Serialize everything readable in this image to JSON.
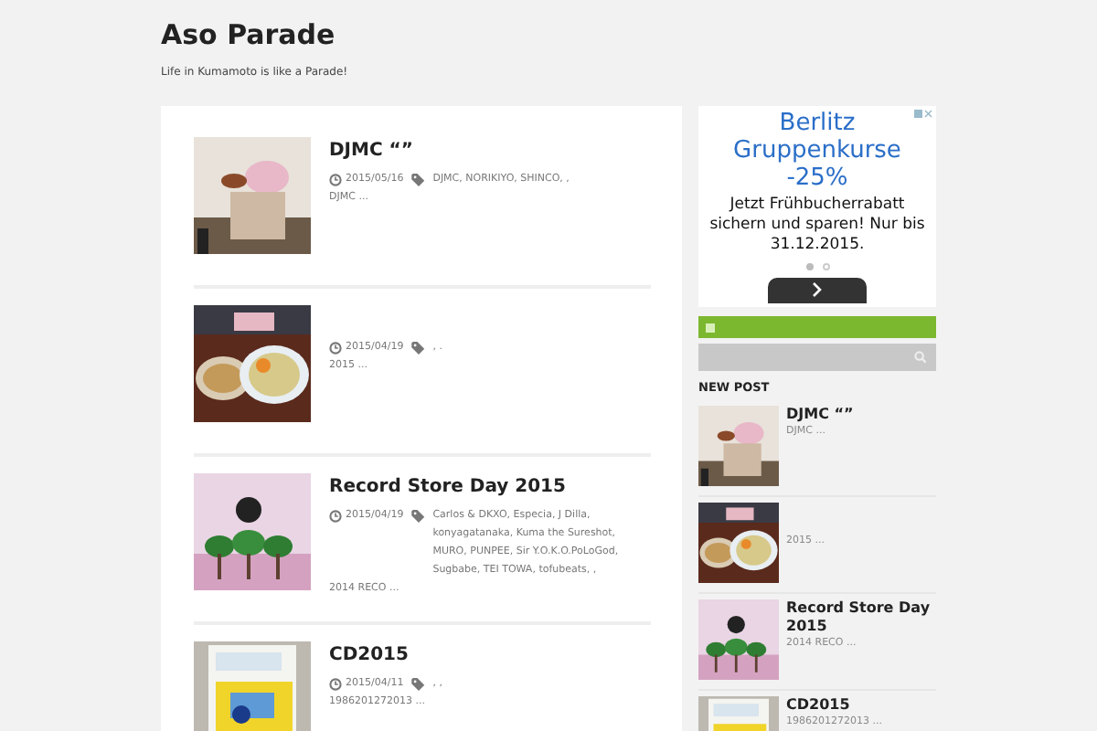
{
  "site": {
    "title": "Aso Parade",
    "tagline": "Life in Kumamoto is like a Parade!"
  },
  "posts": [
    {
      "title": "DJMC “”",
      "date": "2015/05/16",
      "tags": "DJMC, NORIKIYO, SHINCO, ,",
      "excerpt": "DJMC  ..."
    },
    {
      "date": "2015/04/19",
      "tags": ", .",
      "excerpt": "2015 ..."
    },
    {
      "title": "Record Store Day 2015",
      "date": "2015/04/19",
      "tags": "Carlos & DKXO, Especia, J Dilla, konyagatanaka, Kuma the Sureshot, MURO, PUNPEE, Sir Y.O.K.O.PoLoGod, Sugbabe, TEI TOWA, tofubeats, ,",
      "excerpt": "2014 RECO ..."
    },
    {
      "title": "CD2015",
      "date": "2015/04/11",
      "tags": ", ,",
      "excerpt": "1986201272013 ..."
    }
  ],
  "ad": {
    "headline": "Berlitz Gruppenkurse -25%",
    "body": "Jetzt Frühbucherrabatt sichern und sparen! Nur bis 31.12.2015.",
    "dots": [
      {
        "selected": true
      },
      {
        "selected": false
      }
    ]
  },
  "sidebar": {
    "heading": "NEW POST",
    "items": [
      {
        "title": "DJMC “”",
        "excerpt": "DJMC  ..."
      },
      {
        "excerpt": "2015 ..."
      },
      {
        "title": "Record Store Day 2015",
        "excerpt": "2014 RECO ..."
      },
      {
        "title": "CD2015",
        "excerpt": "1986201272013 ..."
      }
    ]
  }
}
